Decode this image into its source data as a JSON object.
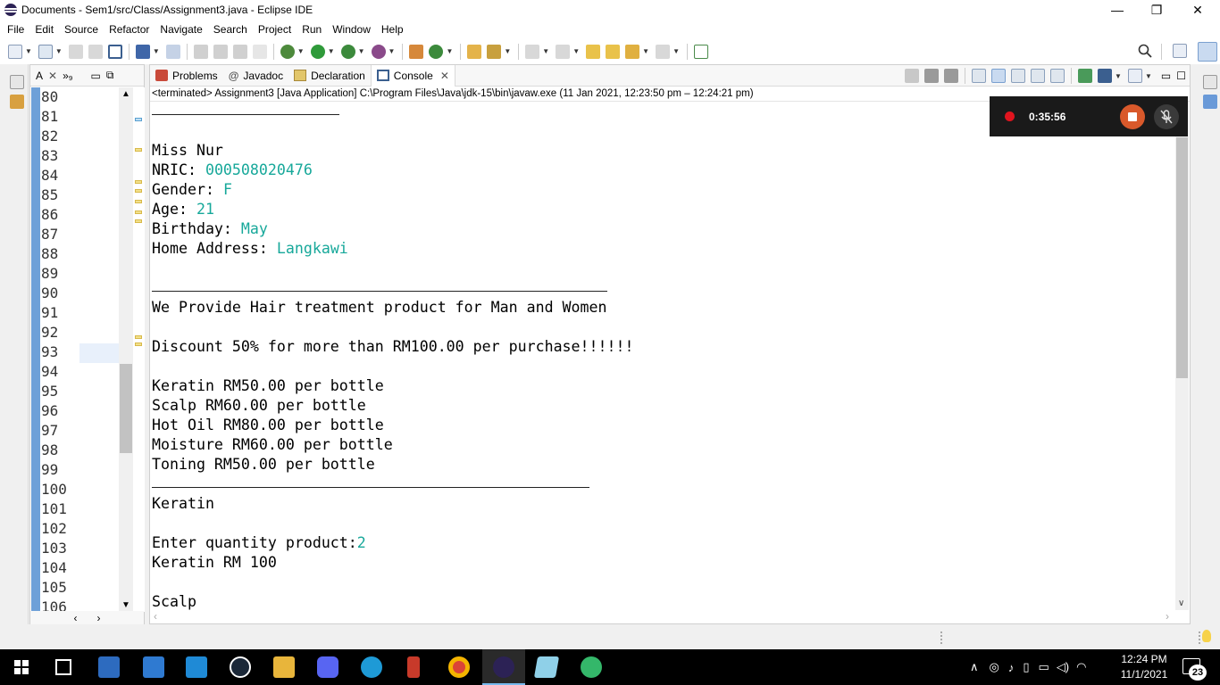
{
  "window": {
    "title": "Documents - Sem1/src/Class/Assignment3.java - Eclipse IDE",
    "minimize": "—",
    "maximize": "❐",
    "close": "✕"
  },
  "menu": [
    "File",
    "Edit",
    "Source",
    "Refactor",
    "Navigate",
    "Search",
    "Project",
    "Run",
    "Window",
    "Help"
  ],
  "editor": {
    "tab_label": "A",
    "tab_close": "✕",
    "overflow": "»₉",
    "line_numbers": [
      "80",
      "81",
      "82",
      "83",
      "84",
      "85",
      "86",
      "87",
      "88",
      "89",
      "90",
      "91",
      "92",
      "93",
      "94",
      "95",
      "96",
      "97",
      "98",
      "99",
      "100",
      "101",
      "102",
      "103",
      "104",
      "105",
      "106"
    ]
  },
  "console_view": {
    "tabs": [
      "Problems",
      "Javadoc",
      "Declaration",
      "Console"
    ],
    "active_tab": "Console",
    "status": "<terminated> Assignment3 [Java Application] C:\\Program Files\\Java\\jdk-15\\bin\\javaw.exe  (11 Jan 2021, 12:23:50 pm – 12:24:21 pm)",
    "lines": [
      {
        "text": "",
        "input": ""
      },
      {
        "text": "",
        "input": ""
      },
      {
        "text": "Miss Nur",
        "input": ""
      },
      {
        "text": "NRIC: ",
        "input": "000508020476"
      },
      {
        "text": "Gender: ",
        "input": "F"
      },
      {
        "text": "Age: ",
        "input": "21"
      },
      {
        "text": "Birthday: ",
        "input": "May"
      },
      {
        "text": "Home Address: ",
        "input": "Langkawi"
      },
      {
        "text": "",
        "input": ""
      },
      {
        "text": "",
        "input": ""
      },
      {
        "text": "We Provide Hair treatment product for Man and Women",
        "input": ""
      },
      {
        "text": "",
        "input": ""
      },
      {
        "text": "Discount 50% for more than RM100.00 per purchase!!!!!!",
        "input": ""
      },
      {
        "text": "",
        "input": ""
      },
      {
        "text": "Keratin RM50.00 per bottle",
        "input": ""
      },
      {
        "text": "Scalp RM60.00 per bottle",
        "input": ""
      },
      {
        "text": "Hot Oil RM80.00 per bottle",
        "input": ""
      },
      {
        "text": "Moisture RM60.00 per bottle",
        "input": ""
      },
      {
        "text": "Toning RM50.00 per bottle",
        "input": ""
      },
      {
        "text": "",
        "input": ""
      },
      {
        "text": "Keratin",
        "input": ""
      },
      {
        "text": "",
        "input": ""
      },
      {
        "text": "Enter quantity product:",
        "input": "2"
      },
      {
        "text": "Keratin RM 100",
        "input": ""
      },
      {
        "text": "",
        "input": ""
      },
      {
        "text": "Scalp",
        "input": ""
      }
    ]
  },
  "recorder": {
    "time": "0:35:56"
  },
  "taskbar": {
    "time": "12:24 PM",
    "date": "11/1/2021",
    "notifications": "23"
  },
  "colors": {
    "stdin_text": "#17a89a",
    "recorder_bg": "#1a1a1a",
    "stop_button": "#d9592b",
    "taskbar_bg": "#000000"
  }
}
